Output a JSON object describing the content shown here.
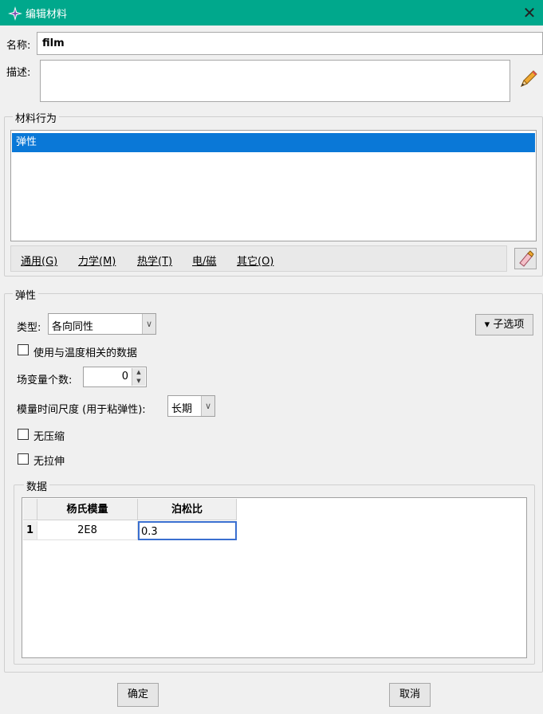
{
  "window": {
    "title": "编辑材料"
  },
  "name": {
    "label": "名称:",
    "value": "film"
  },
  "description": {
    "label": "描述:",
    "value": ""
  },
  "behaviors": {
    "group_title": "材料行为",
    "items": [
      "弹性"
    ]
  },
  "menu": {
    "general": "通用(G)",
    "mechanical": "力学(M)",
    "thermal": "热学(T)",
    "electromagnetic": "电/磁",
    "other": "其它(O)"
  },
  "elastic": {
    "group_title": "弹性",
    "type_label": "类型:",
    "type_value": "各向同性",
    "temp_dependent_label": "使用与温度相关的数据",
    "field_vars_label": "场变量个数:",
    "field_vars_value": "0",
    "timescale_label": "模量时间尺度 (用于粘弹性):",
    "timescale_value": "长期",
    "no_compression_label": "无压缩",
    "no_tension_label": "无拉伸",
    "suboptions_label": "▾ 子选项"
  },
  "data": {
    "group_title": "数据",
    "columns": [
      "杨氏模量",
      "泊松比"
    ],
    "rows": [
      {
        "index": "1",
        "youngs": "2E8",
        "poisson": "0.3"
      }
    ]
  },
  "footer": {
    "ok": "确定",
    "cancel": "取消"
  },
  "colors": {
    "titlebar": "#00a88c",
    "selection": "#0a78d7"
  }
}
